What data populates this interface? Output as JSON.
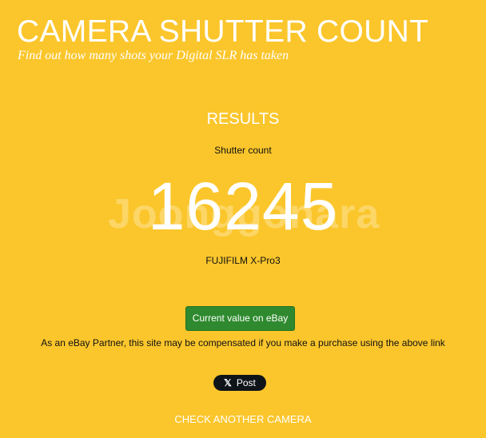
{
  "header": {
    "title": "CAMERA SHUTTER COUNT",
    "tagline": "Find out how many shots your Digital SLR has taken"
  },
  "results": {
    "heading": "RESULTS",
    "count_label": "Shutter count",
    "count_value": "16245",
    "camera_model": "FUJIFILM X-Pro3"
  },
  "ebay": {
    "button_label": "Current value on eBay",
    "disclosure": "As an eBay Partner, this site may be compensated if you make a purchase using the above link"
  },
  "share": {
    "x_icon_glyph": "𝕏",
    "post_label": "Post"
  },
  "footer": {
    "check_another_label": "CHECK ANOTHER CAMERA"
  },
  "watermark": {
    "text": "Joonggonara"
  },
  "colors": {
    "background": "#fbc62c",
    "button_green": "#2f8a2f",
    "x_button": "#0f1419",
    "text_white": "#ffffff",
    "text_dark": "#111111"
  }
}
